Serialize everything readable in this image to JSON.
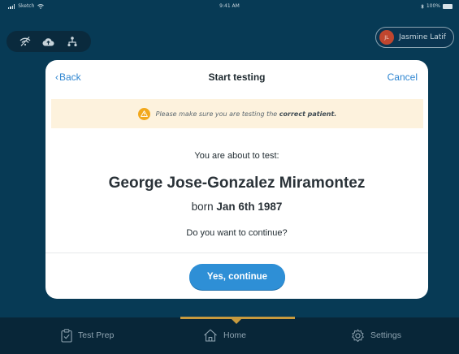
{
  "status_bar": {
    "carrier": "Sketch",
    "time": "9:41 AM",
    "battery": "100%"
  },
  "toolbar": {
    "icons": [
      "wifi-off-icon",
      "cloud-upload-icon",
      "network-icon"
    ]
  },
  "user": {
    "initials": "JL",
    "name": "Jasmine Latif"
  },
  "modal": {
    "back_label": "Back",
    "title": "Start testing",
    "cancel_label": "Cancel",
    "warning_prefix": "Please make sure you are testing the",
    "warning_emphasis": "correct patient.",
    "about_text": "You are about to test:",
    "patient_name": "George Jose-Gonzalez Miramontez",
    "born_prefix": "born",
    "born_date": "Jan 6th 1987",
    "question": "Do you want to continue?",
    "continue_label": "Yes, continue"
  },
  "tabs": {
    "test_prep": "Test Prep",
    "home": "Home",
    "settings": "Settings",
    "active": "home"
  },
  "colors": {
    "background": "#073a55",
    "accent": "#2e8fd6",
    "tab_indicator": "#c79a3e",
    "warning_bg": "#fdf2dd",
    "warning_icon": "#f2a81c"
  }
}
